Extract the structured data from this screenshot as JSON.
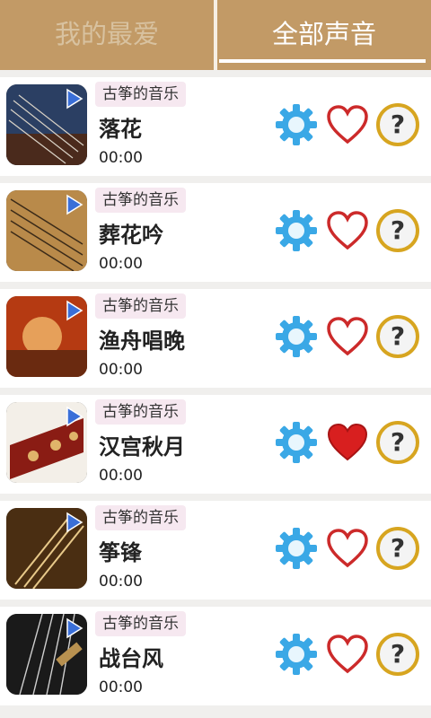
{
  "tabs": {
    "favorites": "我的最爱",
    "all_sounds": "全部声音"
  },
  "items": [
    {
      "tag": "古筝的音乐",
      "title": "落花",
      "time": "00:00",
      "favorited": false
    },
    {
      "tag": "古筝的音乐",
      "title": "葬花吟",
      "time": "00:00",
      "favorited": false
    },
    {
      "tag": "古筝的音乐",
      "title": "渔舟唱晚",
      "time": "00:00",
      "favorited": false
    },
    {
      "tag": "古筝的音乐",
      "title": "汉宫秋月",
      "time": "00:00",
      "favorited": true
    },
    {
      "tag": "古筝的音乐",
      "title": "筝锋",
      "time": "00:00",
      "favorited": false
    },
    {
      "tag": "古筝的音乐",
      "title": "战台风",
      "time": "00:00",
      "favorited": false
    }
  ],
  "colors": {
    "header": "#c29a66",
    "gear": "#3aa8e6",
    "heart_outline": "#cc2a2a",
    "heart_fill": "#d81f1f",
    "help_ring": "#d7a520",
    "play": "#3a6fd8"
  }
}
